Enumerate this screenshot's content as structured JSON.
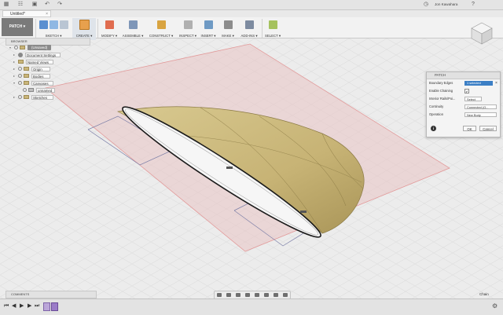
{
  "titlebar": {
    "tab_title": "Untitled*",
    "user_name": "Jon Kawahara"
  },
  "toolbar": {
    "workspace": "PATCH ▾",
    "groups": [
      {
        "label": "SKETCH ▾"
      },
      {
        "label": "CREATE ▾"
      },
      {
        "label": "MODIFY ▾"
      },
      {
        "label": "ASSEMBLE ▾"
      },
      {
        "label": "CONSTRUCT ▾"
      },
      {
        "label": "INSPECT ▾"
      },
      {
        "label": "INSERT ▾"
      },
      {
        "label": "MAKE ▾"
      },
      {
        "label": "ADD-INS ▾"
      },
      {
        "label": "SELECT ▾"
      }
    ]
  },
  "browser": {
    "header": "BROWSER",
    "root": "(Unsaved)",
    "items": [
      {
        "label": "Document Settings"
      },
      {
        "label": "Named Views"
      },
      {
        "label": "Origin"
      },
      {
        "label": "Bodies"
      },
      {
        "label": "Canvases"
      },
      {
        "label": "unnamed"
      },
      {
        "label": "Sketches"
      }
    ]
  },
  "patch_panel": {
    "title": "PATCH",
    "rows": [
      {
        "label": "Boundary Edges",
        "value": "1 selected"
      },
      {
        "label": "Enable Chaining",
        "value": "✔"
      },
      {
        "label": "Interior Rails/Poi...",
        "value": "Select"
      },
      {
        "label": "Continuity",
        "value": "Connected (G..."
      },
      {
        "label": "Operation",
        "value": "New Body"
      }
    ],
    "ok": "OK",
    "cancel": "Cancel",
    "info": "i"
  },
  "comments": {
    "header": "COMMENTS"
  },
  "status": {
    "text": "Chain"
  },
  "colors": {
    "accent": "#3c7fc5",
    "surface": "#c9b57a",
    "plane": "#e7b7b7"
  }
}
